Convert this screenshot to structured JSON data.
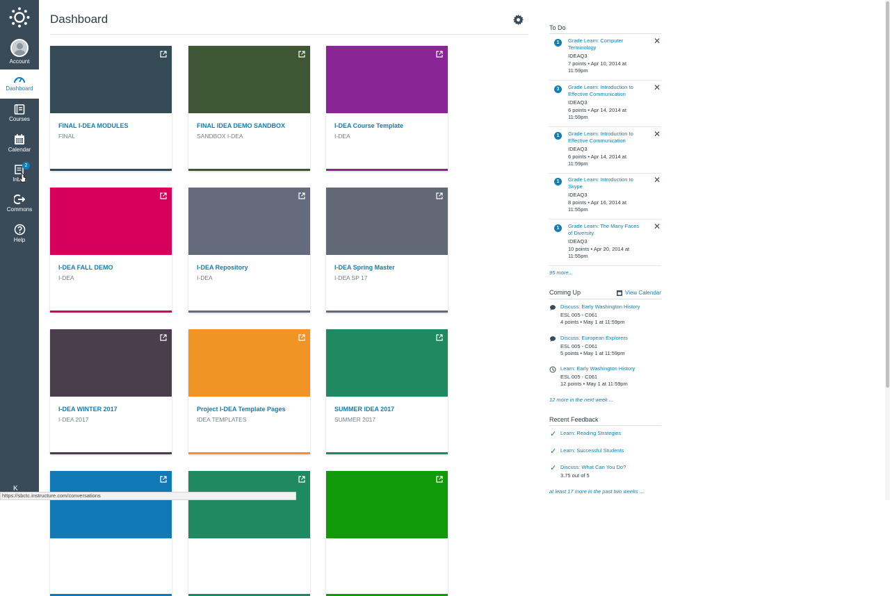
{
  "nav": {
    "items": [
      {
        "label": "Account",
        "icon": "avatar"
      },
      {
        "label": "Dashboard",
        "icon": "dashboard-icon"
      },
      {
        "label": "Courses",
        "icon": "courses-icon"
      },
      {
        "label": "Calendar",
        "icon": "calendar-icon"
      },
      {
        "label": "Inbox",
        "icon": "inbox-icon",
        "badge": "2"
      },
      {
        "label": "Commons",
        "icon": "commons-icon"
      },
      {
        "label": "Help",
        "icon": "help-icon"
      }
    ],
    "collapse_glyph": "K"
  },
  "header": {
    "title": "Dashboard"
  },
  "cards": [
    {
      "title": "FINAL I-DEA MODULES",
      "subtitle": "FINAL",
      "color": "#344b55"
    },
    {
      "title": "FINAL IDEA DEMO SANDBOX",
      "subtitle": "SANDBOX I-DEA",
      "color": "#3f5634"
    },
    {
      "title": "I-DEA Course Template",
      "subtitle": "I-DEA",
      "color": "#8a2595"
    },
    {
      "title": "I-DEA FALL DEMO",
      "subtitle": "I-DEA",
      "color": "#d6005c"
    },
    {
      "title": "I-DEA Repository",
      "subtitle": "I-DEA",
      "color": "#636b7c"
    },
    {
      "title": "I-DEA Spring Master",
      "subtitle": "I-DEA SP 17",
      "color": "#616977"
    },
    {
      "title": "I-DEA WINTER 2017",
      "subtitle": "I-DEA 2017",
      "color": "#4a3d4c"
    },
    {
      "title": "Project I-DEA Template Pages",
      "subtitle": "IDEA TEMPLATES",
      "color": "#ef9425"
    },
    {
      "title": "SUMMER IDEA 2017",
      "subtitle": "SUMMER 2017",
      "color": "#1f8a62"
    },
    {
      "title": "",
      "subtitle": "",
      "color": "#1279b7"
    },
    {
      "title": "",
      "subtitle": "",
      "color": "#1f8a62"
    },
    {
      "title": "",
      "subtitle": "",
      "color": "#109a08"
    }
  ],
  "todo": {
    "title": "To Do",
    "items": [
      {
        "count": "1",
        "title": "Grade Learn: Computer Terminology",
        "course": "IDEAQ3",
        "meta": "7 points • Apr 10, 2014 at 11:59pm"
      },
      {
        "count": "3",
        "title": "Grade Learn: Introduction to Effective Communication",
        "course": "IDEAQ3",
        "meta": "6 points • Apr 14, 2014 at 11:59pm"
      },
      {
        "count": "1",
        "title": "Grade Learn: Introduction to Effective Communication",
        "course": "IDEAQ3",
        "meta": "6 points • Apr 14, 2014 at 11:59pm"
      },
      {
        "count": "1",
        "title": "Grade Learn: Introduction to Skype",
        "course": "IDEAQ3",
        "meta": "8 points • Apr 16, 2014 at 11:55pm"
      },
      {
        "count": "1",
        "title": "Grade Learn: The Many Faces of Diversity",
        "course": "IDEAQ3",
        "meta": "10 points • Apr 20, 2014 at 11:55pm"
      }
    ],
    "more": "95 more..."
  },
  "coming_up": {
    "title": "Coming Up",
    "view_calendar": "View Calendar",
    "items": [
      {
        "icon": "discussion-icon",
        "title": "Discuss: Early Washington History",
        "course": "ESL 005 - C061",
        "meta": "4 points • May 1 at 11:59pm"
      },
      {
        "icon": "discussion-icon",
        "title": "Discuss: European Explorers",
        "course": "ESL 005 - C061",
        "meta": "5 points • May 1 at 11:59pm"
      },
      {
        "icon": "quiz-icon",
        "title": "Learn: Early Washington History",
        "course": "ESL 005 - C061",
        "meta": "12 points • May 1 at 11:59pm"
      }
    ],
    "more": "12 more in the next week ..."
  },
  "feedback": {
    "title": "Recent Feedback",
    "items": [
      {
        "title": "Learn: Reading Strategies",
        "score": ""
      },
      {
        "title": "Learn: Successful Students",
        "score": ""
      },
      {
        "title": "Discuss: What Can You Do?",
        "score": "3.75 out of 5"
      }
    ],
    "more": "at least 17 more in the past two weeks ..."
  },
  "status_bar": {
    "url": "https://sbctc.instructure.com/conversations"
  }
}
